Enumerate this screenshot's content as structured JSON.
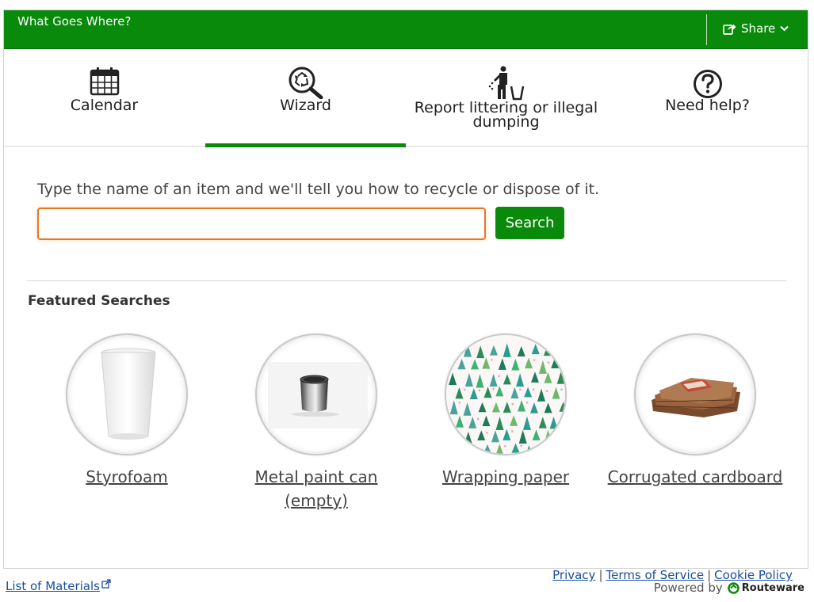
{
  "header": {
    "app_title": "What Goes Where?",
    "share_label": "Share"
  },
  "tabs": [
    {
      "label": "Calendar",
      "icon": "calendar-icon",
      "active": false
    },
    {
      "label": "Wizard",
      "icon": "recycle-search-icon",
      "active": true
    },
    {
      "label": "Report littering or illegal dumping",
      "icon": "littering-icon",
      "active": false
    },
    {
      "label": "Need help?",
      "icon": "question-icon",
      "active": false
    }
  ],
  "search": {
    "prompt": "Type the name of an item and we'll tell you how to recycle or dispose of it.",
    "value": "",
    "button_label": "Search"
  },
  "featured": {
    "title": "Featured Searches",
    "items": [
      {
        "label": "Styrofoam",
        "image": "styrofoam-cup-image"
      },
      {
        "label": "Metal paint can (empty)",
        "image": "paint-can-image"
      },
      {
        "label": "Wrapping paper",
        "image": "wrapping-paper-image"
      },
      {
        "label": "Corrugated cardboard",
        "image": "cardboard-image"
      }
    ]
  },
  "footer": {
    "privacy": "Privacy",
    "terms": "Terms of Service",
    "cookie": "Cookie Policy",
    "powered_by": "Powered by",
    "brand": "Routeware",
    "list_of_materials": "List of Materials"
  },
  "colors": {
    "brand_green": "#0a8a0a",
    "input_focus": "#e87722",
    "link_blue": "#1a4fa0"
  }
}
